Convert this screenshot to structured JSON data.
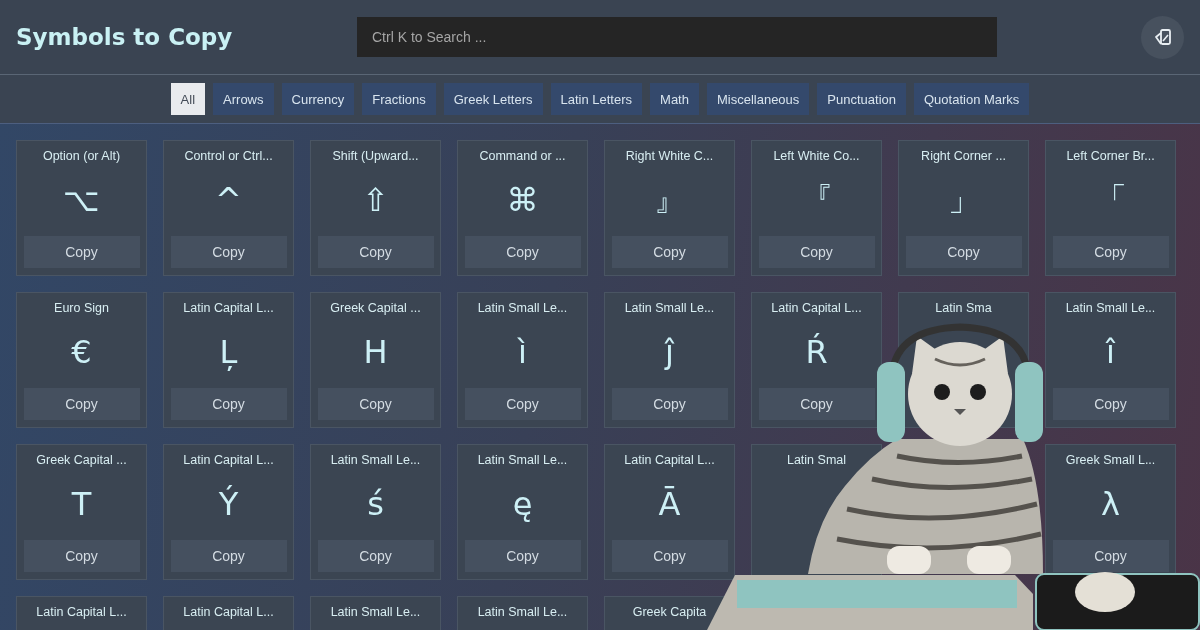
{
  "header": {
    "title": "Symbols to Copy",
    "search": {
      "placeholder": "Ctrl K to Search ..."
    }
  },
  "filters": [
    {
      "label": "All",
      "selected": true
    },
    {
      "label": "Arrows",
      "selected": false
    },
    {
      "label": "Currency",
      "selected": false
    },
    {
      "label": "Fractions",
      "selected": false
    },
    {
      "label": "Greek Letters",
      "selected": false
    },
    {
      "label": "Latin Letters",
      "selected": false
    },
    {
      "label": "Math",
      "selected": false
    },
    {
      "label": "Miscellaneous",
      "selected": false
    },
    {
      "label": "Punctuation",
      "selected": false
    },
    {
      "label": "Quotation Marks",
      "selected": false
    }
  ],
  "cards": [
    {
      "title": "Option (or Alt)",
      "symbol": "⌥",
      "button": "Copy"
    },
    {
      "title": "Control or Ctrl...",
      "symbol": "^",
      "button": "Copy"
    },
    {
      "title": "Shift (Upward...",
      "symbol": "⇧",
      "button": "Copy"
    },
    {
      "title": "Command or ...",
      "symbol": "⌘",
      "button": "Copy"
    },
    {
      "title": "Right White C...",
      "symbol": "』",
      "button": "Copy"
    },
    {
      "title": "Left White Co...",
      "symbol": "『",
      "button": "Copy"
    },
    {
      "title": "Right Corner ...",
      "symbol": "」",
      "button": "Copy"
    },
    {
      "title": "Left Corner Br...",
      "symbol": "「",
      "button": "Copy"
    },
    {
      "title": "Euro Sign",
      "symbol": "€",
      "button": "Copy"
    },
    {
      "title": "Latin Capital L...",
      "symbol": "Ļ",
      "button": "Copy"
    },
    {
      "title": "Greek Capital ...",
      "symbol": "Η",
      "button": "Copy"
    },
    {
      "title": "Latin Small Le...",
      "symbol": "ì",
      "button": "Copy"
    },
    {
      "title": "Latin Small Le...",
      "symbol": "ĵ",
      "button": "Copy"
    },
    {
      "title": "Latin Capital L...",
      "symbol": "Ŕ",
      "button": "Copy"
    },
    {
      "title": "Latin Sma"
    },
    {
      "title": "Latin Small Le...",
      "symbol": "î",
      "button": "Copy"
    },
    {
      "title": "Greek Capital ...",
      "symbol": "Τ",
      "button": "Copy"
    },
    {
      "title": "Latin Capital L...",
      "symbol": "Ý",
      "button": "Copy"
    },
    {
      "title": "Latin Small Le...",
      "symbol": "ś",
      "button": "Copy"
    },
    {
      "title": "Latin Small Le...",
      "symbol": "ę",
      "button": "Copy"
    },
    {
      "title": "Latin Capital L...",
      "symbol": "Ā",
      "button": "Copy"
    },
    {
      "title": "Latin Smal"
    },
    {
      "kind": "covered"
    },
    {
      "title": "Greek Small L...",
      "symbol": "λ",
      "button": "Copy"
    },
    {
      "title": "Latin Capital L..."
    },
    {
      "title": "Latin Capital L..."
    },
    {
      "title": "Latin Small Le..."
    },
    {
      "title": "Latin Small Le..."
    },
    {
      "title": "Greek Capita"
    }
  ]
}
